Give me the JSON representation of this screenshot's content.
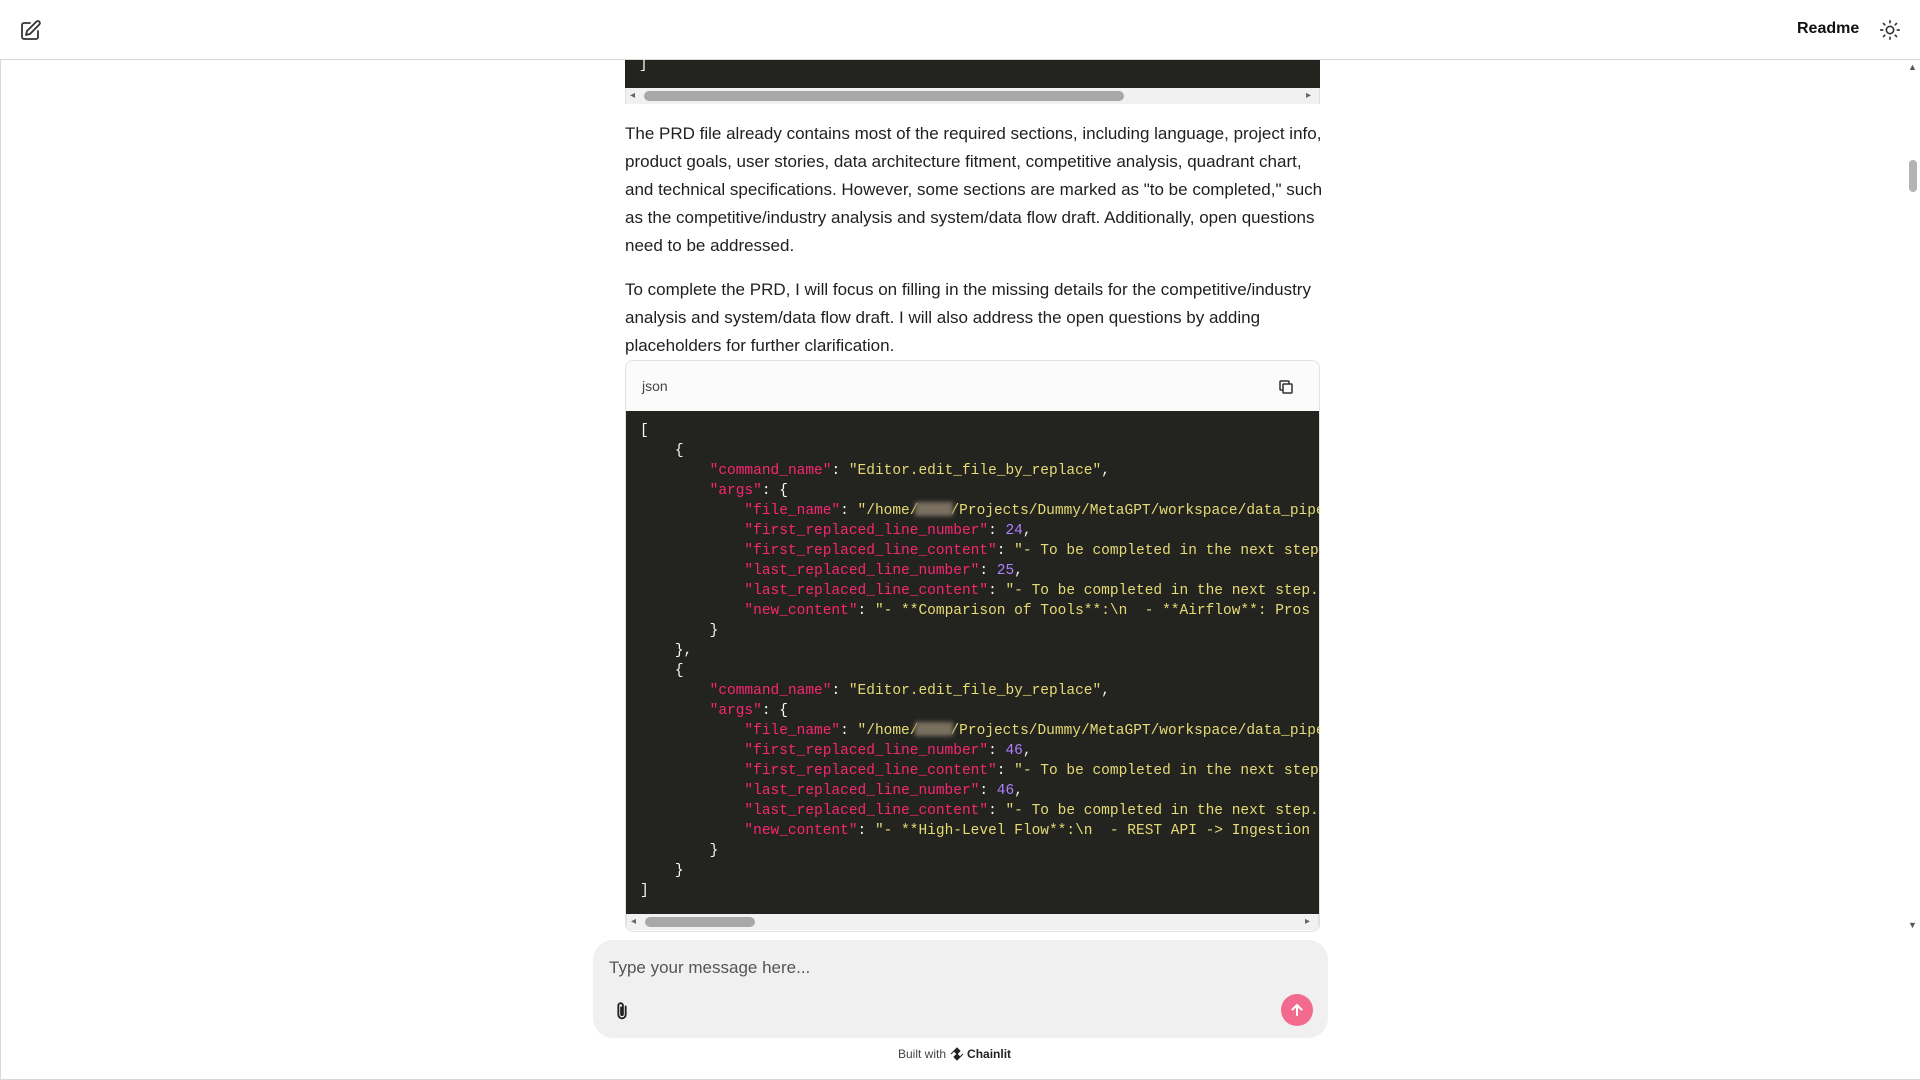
{
  "header": {
    "readme_label": "Readme"
  },
  "messages": {
    "paragraph1": "The PRD file already contains most of the required sections, including language, project info, product goals, user stories, data architecture fitment, competitive analysis, quadrant chart, and technical specifications. However, some sections are marked as \"to be completed,\" such as the competitive/industry analysis and system/data flow draft. Additionally, open questions need to be addressed.",
    "paragraph2": "To complete the PRD, I will focus on filling in the missing details for the competitive/industry analysis and system/data flow draft. I will also address the open questions by adding placeholders for further clarification."
  },
  "code_tail": {
    "bracket": "]"
  },
  "code_block": {
    "language": "json",
    "open_bracket": "[",
    "close_bracket": "]",
    "open_brace": "{",
    "close_brace": "}",
    "close_brace_comma": "},",
    "key_command_name": "\"command_name\"",
    "key_args": "\"args\"",
    "key_file_name": "\"file_name\"",
    "key_first_num": "\"first_replaced_line_number\"",
    "key_first_content": "\"first_replaced_line_content\"",
    "key_last_num": "\"last_replaced_line_number\"",
    "key_last_content": "\"last_replaced_line_content\"",
    "key_new_content": "\"new_content\"",
    "cmd_value": "\"Editor.edit_file_by_replace\"",
    "path_prefix": "\"/home/",
    "path_suffix": "/Projects/Dummy/MetaGPT/workspace/data_pipeli",
    "todo_value": "\"- To be completed in the next step.\"",
    "cmd1": {
      "first_num": "24",
      "last_num": "25",
      "new_content": "\"- **Comparison of Tools**:\\n  - **Airflow**: Pros - F"
    },
    "cmd2": {
      "first_num": "46",
      "last_num": "46",
      "new_content": "\"- **High-Level Flow**:\\n  - REST API -> Ingestion Lay"
    }
  },
  "composer": {
    "placeholder": "Type your message here..."
  },
  "footer": {
    "built_with": "Built with",
    "brand": "Chainlit"
  },
  "colors": {
    "send_button": "#f26a8d",
    "code_bg": "#232320",
    "json_key": "#f92672",
    "json_string": "#e6db74",
    "json_number": "#ae81ff"
  }
}
